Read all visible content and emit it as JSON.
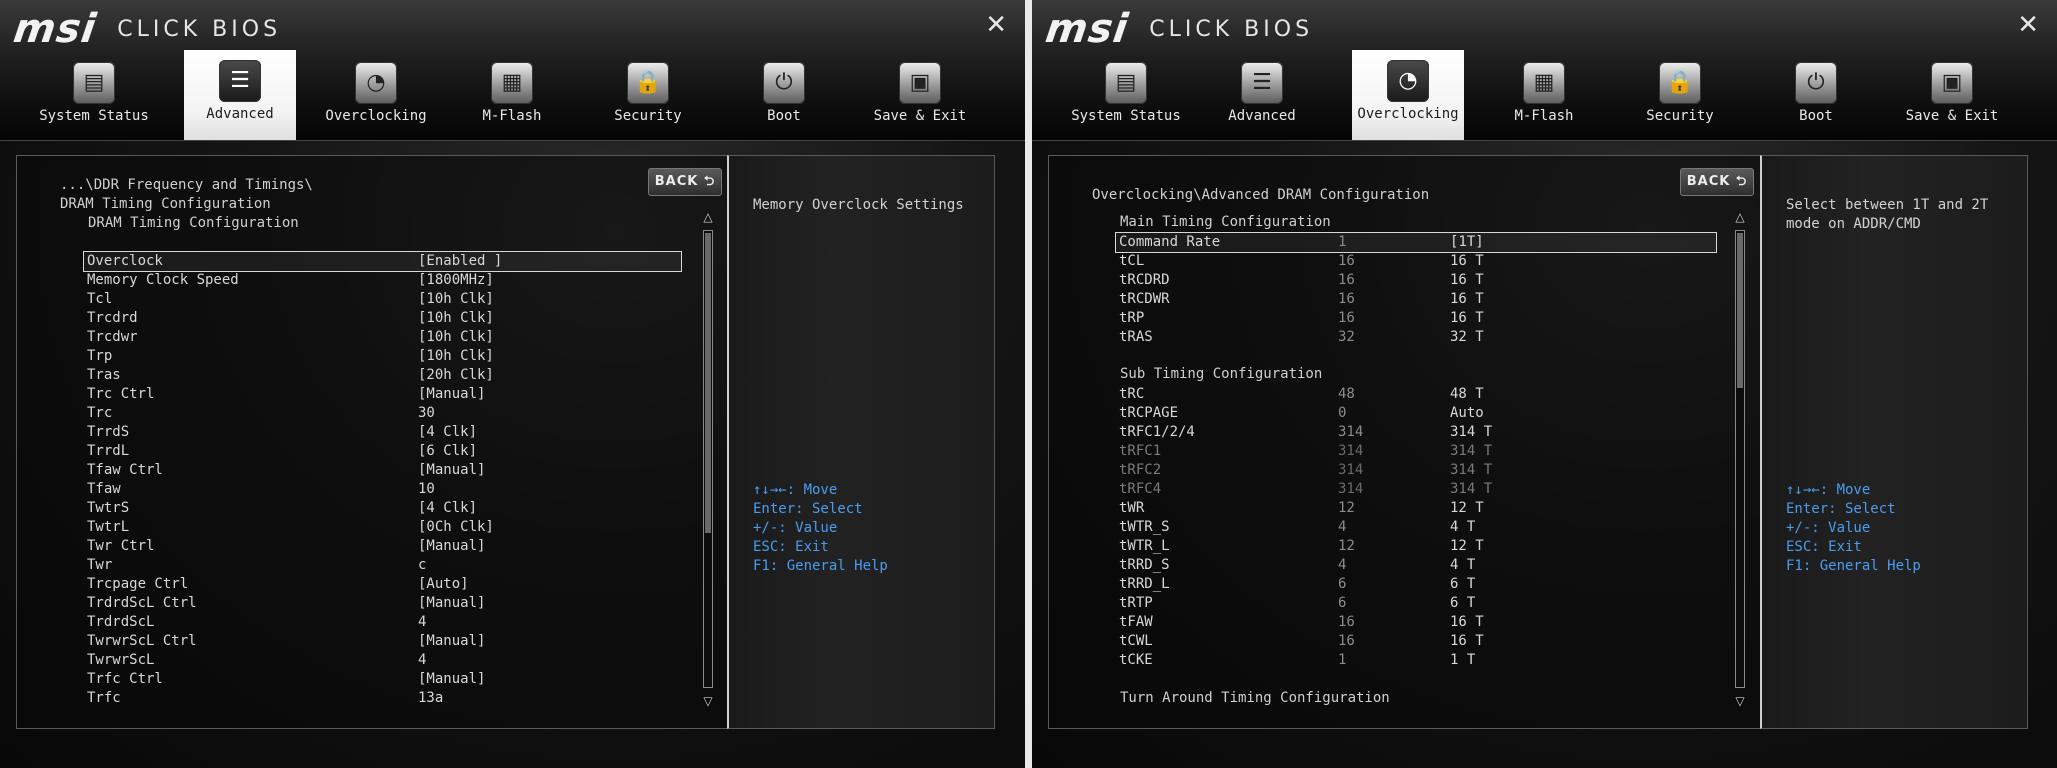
{
  "left": {
    "logo_brand": "msi",
    "logo_product": "CLICK BIOS",
    "close": "✕",
    "tabs": [
      {
        "label": "System Status",
        "icon": "▤"
      },
      {
        "label": "Advanced",
        "icon": "☰"
      },
      {
        "label": "Overclocking",
        "icon": "◔"
      },
      {
        "label": "M-Flash",
        "icon": "▦"
      },
      {
        "label": "Security",
        "icon": "🔒"
      },
      {
        "label": "Boot",
        "icon": "⏻"
      },
      {
        "label": "Save & Exit",
        "icon": "▣"
      }
    ],
    "active_tab": "Advanced",
    "back_label": "BACK ⮌",
    "crumb1": "...\\DDR Frequency and Timings\\",
    "crumb2": "DRAM Timing Configuration",
    "crumb3": "DRAM Timing Configuration",
    "rows": [
      {
        "name": "Overclock",
        "value": "[Enabled ]"
      },
      {
        "name": "Memory Clock Speed",
        "value": "[1800MHz]"
      },
      {
        "name": "Tcl",
        "value": "[10h Clk]"
      },
      {
        "name": "Trcdrd",
        "value": "[10h Clk]"
      },
      {
        "name": "Trcdwr",
        "value": "[10h Clk]"
      },
      {
        "name": "Trp",
        "value": "[10h Clk]"
      },
      {
        "name": "Tras",
        "value": "[20h Clk]"
      },
      {
        "name": "Trc Ctrl",
        "value": "[Manual]"
      },
      {
        "name": "Trc",
        "value": "30"
      },
      {
        "name": "TrrdS",
        "value": "[4 Clk]"
      },
      {
        "name": "TrrdL",
        "value": "[6 Clk]"
      },
      {
        "name": "Tfaw Ctrl",
        "value": "[Manual]"
      },
      {
        "name": "Tfaw",
        "value": "10"
      },
      {
        "name": "TwtrS",
        "value": "[4 Clk]"
      },
      {
        "name": "TwtrL",
        "value": "[0Ch Clk]"
      },
      {
        "name": "Twr Ctrl",
        "value": "[Manual]"
      },
      {
        "name": "Twr",
        "value": "c"
      },
      {
        "name": "Trcpage Ctrl",
        "value": "[Auto]"
      },
      {
        "name": "TrdrdScL Ctrl",
        "value": "[Manual]"
      },
      {
        "name": "TrdrdScL",
        "value": "4"
      },
      {
        "name": "TwrwrScL Ctrl",
        "value": "[Manual]"
      },
      {
        "name": "TwrwrScL",
        "value": "4"
      },
      {
        "name": "Trfc Ctrl",
        "value": "[Manual]"
      },
      {
        "name": "Trfc",
        "value": "13a"
      }
    ],
    "help_text": "Memory Overclock Settings",
    "keys": [
      "↑↓→←: Move",
      "Enter: Select",
      "+/-: Value",
      "ESC: Exit",
      "F1: General Help"
    ]
  },
  "right": {
    "logo_brand": "msi",
    "logo_product": "CLICK BIOS",
    "close": "✕",
    "tabs": [
      {
        "label": "System Status",
        "icon": "▤"
      },
      {
        "label": "Advanced",
        "icon": "☰"
      },
      {
        "label": "Overclocking",
        "icon": "◔"
      },
      {
        "label": "M-Flash",
        "icon": "▦"
      },
      {
        "label": "Security",
        "icon": "🔒"
      },
      {
        "label": "Boot",
        "icon": "⏻"
      },
      {
        "label": "Save & Exit",
        "icon": "▣"
      }
    ],
    "active_tab": "Overclocking",
    "back_label": "BACK ⮌",
    "crumb1": "Overclocking\\Advanced DRAM Configuration",
    "section_main": "Main Timing Configuration",
    "main_rows": [
      {
        "name": "Command Rate",
        "default": "1",
        "value": "[1T]"
      },
      {
        "name": "tCL",
        "default": "16",
        "value": "16 T"
      },
      {
        "name": "tRCDRD",
        "default": "16",
        "value": "16 T"
      },
      {
        "name": "tRCDWR",
        "default": "16",
        "value": "16 T"
      },
      {
        "name": "tRP",
        "default": "16",
        "value": "16 T"
      },
      {
        "name": "tRAS",
        "default": "32",
        "value": "32 T"
      }
    ],
    "section_sub": "Sub Timing Configuration",
    "sub_rows": [
      {
        "name": "tRC",
        "default": "48",
        "value": "48 T"
      },
      {
        "name": "tRCPAGE",
        "default": "0",
        "value": "Auto"
      },
      {
        "name": "tRFC1/2/4",
        "default": "314",
        "value": "314 T"
      },
      {
        "name": "tRFC1",
        "default": "314",
        "value": "314 T"
      },
      {
        "name": "tRFC2",
        "default": "314",
        "value": "314 T"
      },
      {
        "name": "tRFC4",
        "default": "314",
        "value": "314 T"
      },
      {
        "name": "tWR",
        "default": "12",
        "value": "12 T"
      },
      {
        "name": "tWTR_S",
        "default": "4",
        "value": "4 T"
      },
      {
        "name": "tWTR_L",
        "default": "12",
        "value": "12 T"
      },
      {
        "name": "tRRD_S",
        "default": "4",
        "value": "4 T"
      },
      {
        "name": "tRRD_L",
        "default": "6",
        "value": "6 T"
      },
      {
        "name": "tRTP",
        "default": "6",
        "value": "6 T"
      },
      {
        "name": "tFAW",
        "default": "16",
        "value": "16 T"
      },
      {
        "name": "tCWL",
        "default": "16",
        "value": "16 T"
      },
      {
        "name": "tCKE",
        "default": "1",
        "value": "1 T"
      }
    ],
    "section_turn": "Turn Around Timing Configuration",
    "help_text": "Select between 1T and 2T mode on ADDR/CMD",
    "keys": [
      "↑↓→←: Move",
      "Enter: Select",
      "+/-: Value",
      "ESC: Exit",
      "F1: General Help"
    ]
  }
}
